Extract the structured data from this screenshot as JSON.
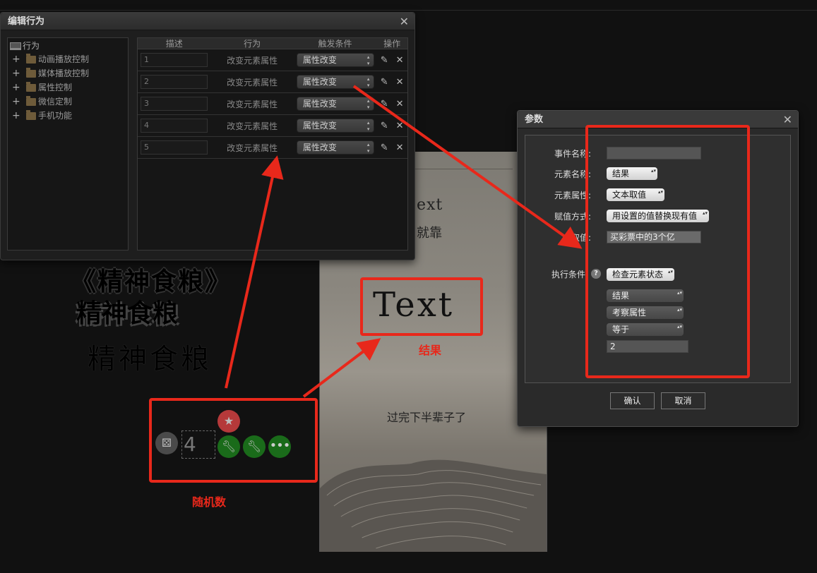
{
  "behavior_window": {
    "title": "编辑行为",
    "tree": {
      "root": "行为",
      "items": [
        "动画播放控制",
        "媒体播放控制",
        "属性控制",
        "微信定制",
        "手机功能"
      ]
    },
    "grid": {
      "headers": [
        "描述",
        "行为",
        "触发条件",
        "操作"
      ],
      "rows": [
        {
          "desc": "1",
          "action": "改变元素属性",
          "trigger": "属性改变"
        },
        {
          "desc": "2",
          "action": "改变元素属性",
          "trigger": "属性改变"
        },
        {
          "desc": "3",
          "action": "改变元素属性",
          "trigger": "属性改变"
        },
        {
          "desc": "4",
          "action": "改变元素属性",
          "trigger": "属性改变"
        },
        {
          "desc": "5",
          "action": "改变元素属性",
          "trigger": "属性改变"
        }
      ]
    }
  },
  "params_window": {
    "title": "参数",
    "labels": {
      "event_name": "事件名称:",
      "element_name": "元素名称:",
      "element_attr": "元素属性:",
      "assign_mode": "赋值方式:",
      "value": "取值:",
      "exec_condition": "执行条件:"
    },
    "values": {
      "event_name": "",
      "element_name": "结果",
      "element_attr": "文本取值",
      "assign_mode": "用设置的值替换现有值",
      "value": "买彩票中的3个亿",
      "exec_condition": "检查元素状态",
      "cond_element": "结果",
      "cond_attr": "考察属性",
      "cond_op": "等于",
      "cond_value": "2"
    },
    "help_glyph": "?",
    "buttons": {
      "confirm": "确认",
      "cancel": "取消"
    }
  },
  "stage": {
    "text_top": "ext",
    "text_cn": "就靠",
    "text_big": "Text",
    "text_bottom": "过完下半辈子了"
  },
  "blurred_text": {
    "line1": "《精神食粮》",
    "line2": "精神食粮",
    "line3": "精神食粮"
  },
  "toolbar": {
    "number": "4"
  },
  "annotations": {
    "result_label": "结果",
    "random_label": "随机数",
    "color": "#e8281b"
  },
  "icons": [
    "pc-icon",
    "folder-icon",
    "plus-icon",
    "pencil-icon",
    "close-icon",
    "dice-icon",
    "star-add-icon",
    "wrench-icon",
    "more-icon",
    "help-icon"
  ]
}
